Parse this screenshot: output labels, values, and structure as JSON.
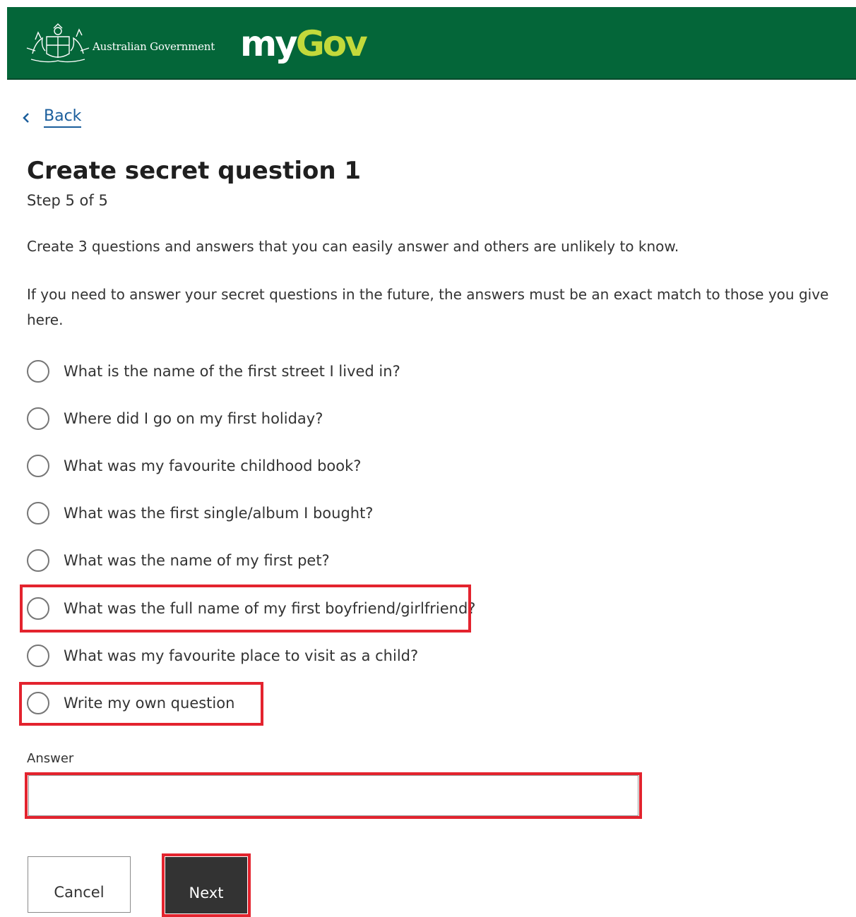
{
  "header": {
    "government_text": "Australian Government",
    "logo_my": "my",
    "logo_gov": "Gov",
    "background_color": "#046639",
    "logo_accent_color": "#c3d93b"
  },
  "nav": {
    "back_label": "Back"
  },
  "page": {
    "title": "Create secret question 1",
    "step": "Step 5 of 5",
    "intro": "Create 3 questions and answers that you can easily answer and others are unlikely to know.",
    "note": "If you need to answer your secret questions in the future, the answers must be an exact match to those you give here."
  },
  "questions": [
    "What is the name of the first street I lived in?",
    "Where did I go on my first holiday?",
    "What was my favourite childhood book?",
    "What was the first single/album I bought?",
    "What was the name of my first pet?",
    "What was the full name of my first boyfriend/girlfriend?",
    "What was my favourite place to visit as a child?",
    "Write my own question"
  ],
  "answer": {
    "label": "Answer",
    "value": ""
  },
  "buttons": {
    "cancel": "Cancel",
    "next": "Next"
  },
  "highlight_color": "#e3232e"
}
